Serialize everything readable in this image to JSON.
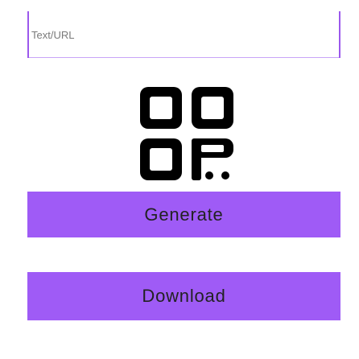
{
  "input": {
    "placeholder": "Text/URL",
    "value": ""
  },
  "qr_preview": {
    "icon": "qr-code-icon"
  },
  "buttons": {
    "generate_label": "Generate",
    "download_label": "Download"
  },
  "colors": {
    "accent": "#9f5bf6",
    "border": "#9b58ec",
    "text": "#222222",
    "qr": "#000000"
  }
}
